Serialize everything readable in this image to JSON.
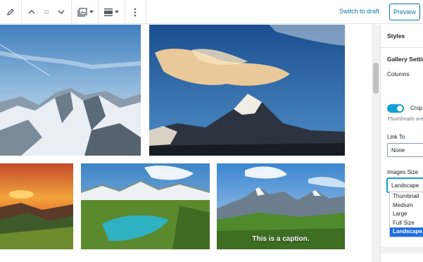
{
  "toolbar": {
    "switch_to_draft": "Switch to draft",
    "preview": "Preview",
    "icons": [
      "pencil-icon",
      "chevron-up-icon",
      "drag-handle-icon",
      "chevron-down-icon",
      "gallery-icon",
      "caret-down-icon",
      "align-icon",
      "caret-down-icon",
      "more-vertical-icon"
    ]
  },
  "gallery": {
    "images": [
      {
        "name": "snowy-mountain-range"
      },
      {
        "name": "peak-with-cloud"
      },
      {
        "name": "sunset-hills"
      },
      {
        "name": "alpine-lake"
      },
      {
        "name": "green-valley-peaks",
        "caption": "This is a caption."
      }
    ]
  },
  "sidebar": {
    "tab": "Styles",
    "section": "Gallery Settings",
    "columns_label": "Columns",
    "crop_label": "Crop images",
    "crop_help": "Thumbnails are cropped to align.",
    "crop_enabled": true,
    "link_to_label": "Link To",
    "link_to_value": "None",
    "image_size_label": "Images Size",
    "image_size_value": "Landscape",
    "image_size_options": [
      "Thumbnail",
      "Medium",
      "Large",
      "Full Size",
      "Landscape"
    ],
    "image_size_selected_index": 4
  },
  "colors": {
    "accent": "#0a7aa8",
    "toggle_on": "#11a0d2",
    "option_selected": "#1e6fe0"
  }
}
